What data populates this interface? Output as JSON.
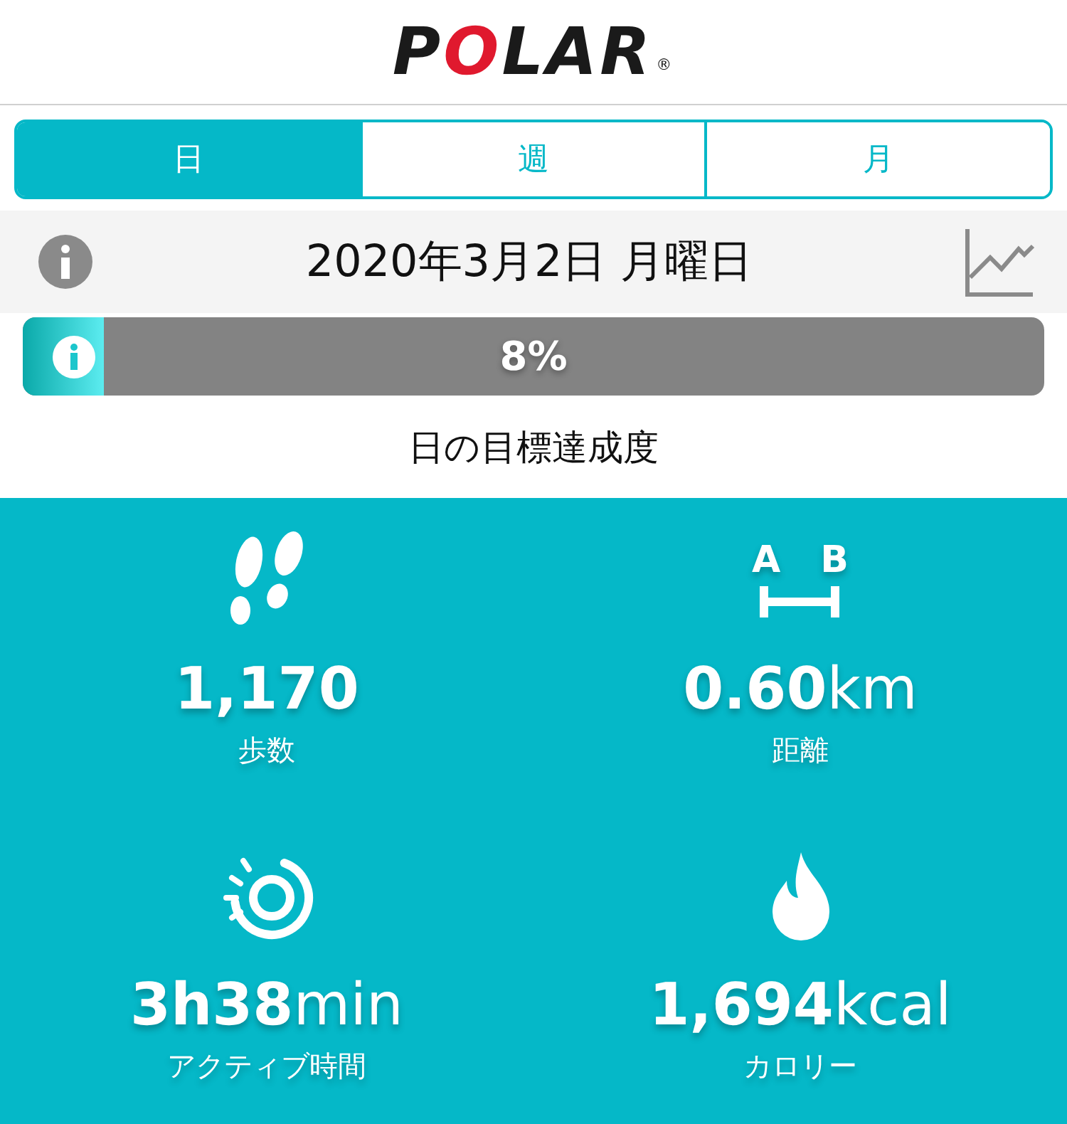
{
  "header": {
    "logo": "POLAR",
    "registered": "®"
  },
  "tabs": [
    {
      "label": "日",
      "selected": true
    },
    {
      "label": "週",
      "selected": false
    },
    {
      "label": "月",
      "selected": false
    }
  ],
  "date_bar": {
    "date": "2020年3月2日 月曜日"
  },
  "goal": {
    "level": 0.08,
    "reading": "8%",
    "caption": "日の目標達成度"
  },
  "stat_rows": [
    {
      "items": [
        {
          "kind": "steps",
          "value": "1,170",
          "label": "歩数"
        },
        {
          "kind": "distance",
          "point_a": "A",
          "point_b": "B",
          "value": "0.60",
          "unit": "km",
          "label": "距離"
        }
      ]
    },
    {
      "items": [
        {
          "kind": "active",
          "value": "3h38",
          "unit": "min",
          "label": "アクティブ時間"
        },
        {
          "kind": "calories",
          "value": "1,694",
          "unit": "kcal",
          "label": "カロリー"
        }
      ]
    }
  ]
}
